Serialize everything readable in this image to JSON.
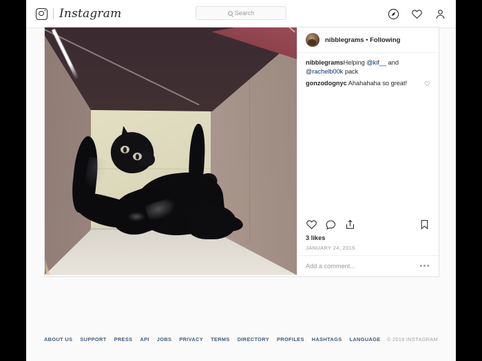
{
  "header": {
    "camera_icon": "instagram-camera-icon",
    "wordmark": "Instagram",
    "search": {
      "placeholder": "Search",
      "value": "",
      "icon": "search-icon"
    },
    "nav_icons": [
      {
        "name": "explore-compass-icon"
      },
      {
        "name": "activity-heart-icon"
      },
      {
        "name": "profile-person-icon"
      }
    ]
  },
  "post": {
    "author": "nibblegrams",
    "separator": "•",
    "follow_status": "Following",
    "avatar": "user-avatar",
    "image_alt": "black-cat-inside-cardboard-box",
    "caption": {
      "user": "nibblegrams",
      "pre": "Helping ",
      "mention1": "@kif__",
      "mid": " and ",
      "mention2": "@rachelb00k",
      "post": " pack"
    },
    "comment": {
      "user": "gonzodognyc",
      "text": "Ahahahaha so great!"
    },
    "actions": [
      {
        "name": "like-heart-icon"
      },
      {
        "name": "comment-bubble-icon"
      },
      {
        "name": "share-icon"
      },
      {
        "name": "bookmark-icon"
      }
    ],
    "likes": "3 likes",
    "date": "JANUARY 24, 2015",
    "add_comment_placeholder": "Add a comment...",
    "more_options": "•••"
  },
  "footer": {
    "links": [
      "ABOUT US",
      "SUPPORT",
      "PRESS",
      "API",
      "JOBS",
      "PRIVACY",
      "TERMS",
      "DIRECTORY",
      "PROFILES",
      "HASHTAGS",
      "LANGUAGE"
    ],
    "copyright": "© 2018 INSTAGRAM"
  },
  "colors": {
    "page_bg": "#fafafa",
    "card_bg": "#ffffff",
    "text": "#262626",
    "muted": "#999999",
    "link": "#003569",
    "footer_link": "#3f5b7d",
    "border": "#e1e1e1"
  }
}
